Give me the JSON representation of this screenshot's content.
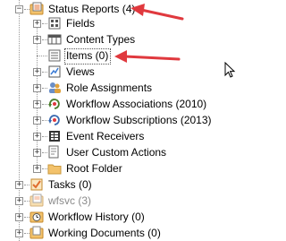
{
  "tree": {
    "status_reports": {
      "label": "Status Reports (4)",
      "icon": "list-folder-icon",
      "expanded": true
    },
    "children": [
      {
        "label": "Fields",
        "icon": "fields-icon",
        "expander": "+"
      },
      {
        "label": "Content Types",
        "icon": "content-types-icon",
        "expander": "+"
      },
      {
        "label": "Items (0)",
        "icon": "items-list-icon",
        "expander": "",
        "selected": true
      },
      {
        "label": "Views",
        "icon": "views-icon",
        "expander": "+"
      },
      {
        "label": "Role Assignments",
        "icon": "role-assignments-icon",
        "expander": "+"
      },
      {
        "label": "Workflow Associations (2010)",
        "icon": "workflow-2010-icon",
        "expander": "+"
      },
      {
        "label": "Workflow Subscriptions (2013)",
        "icon": "workflow-2013-icon",
        "expander": "+"
      },
      {
        "label": "Event Receivers",
        "icon": "event-receivers-icon",
        "expander": "+"
      },
      {
        "label": "User Custom Actions",
        "icon": "user-custom-actions-icon",
        "expander": "+"
      },
      {
        "label": "Root Folder",
        "icon": "folder-icon",
        "expander": "+"
      }
    ],
    "siblings": [
      {
        "label": "Tasks (0)",
        "icon": "tasks-icon",
        "expander": "+",
        "dimmed": false
      },
      {
        "label": "wfsvc (3)",
        "icon": "wfsvc-icon",
        "expander": "+",
        "dimmed": true
      },
      {
        "label": "Workflow History (0)",
        "icon": "workflow-history-icon",
        "expander": "+",
        "dimmed": false
      },
      {
        "label": "Working Documents (0)",
        "icon": "working-documents-icon",
        "expander": "+",
        "dimmed": false
      }
    ]
  },
  "colors": {
    "annotation_arrow": "#e0393e",
    "folder": "#f3c26b",
    "dimmed_text": "#8a8a8a"
  }
}
